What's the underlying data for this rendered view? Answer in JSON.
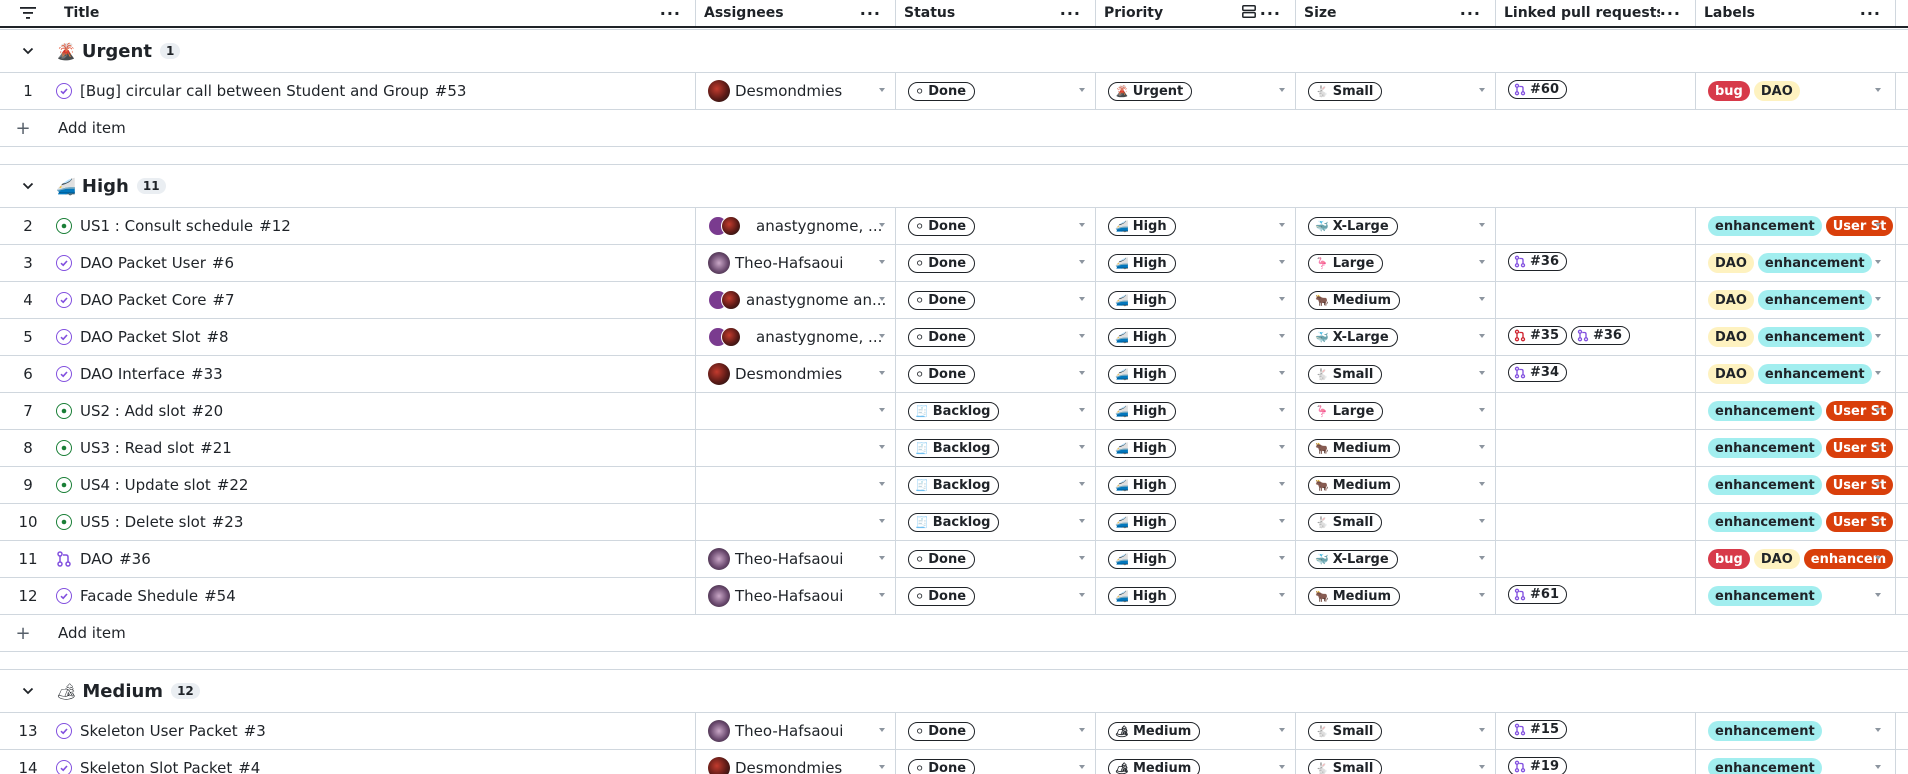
{
  "header": {
    "columns": [
      "Title",
      "Assignees",
      "Status",
      "Priority",
      "Size",
      "Linked pull requests",
      "Labels"
    ]
  },
  "groups": [
    {
      "icon": "🌋",
      "name": "Urgent",
      "count": "1"
    },
    {
      "icon": "🚄",
      "name": "High",
      "count": "11"
    },
    {
      "icon": "🏕",
      "name": "Medium",
      "count": "12"
    }
  ],
  "add_item_label": "Add item",
  "rows": [
    {
      "num": "1",
      "state": "closed",
      "title": "[Bug] circular call between Student and Group",
      "ref": "#53",
      "assignee": "Desmondmies",
      "status": "Done",
      "priority": "Urgent",
      "size": "Small",
      "prs": [
        "#60"
      ],
      "labels": [
        "bug",
        "DAO"
      ]
    },
    {
      "num": "2",
      "state": "open",
      "title": "US1 : Consult schedule",
      "ref": "#12",
      "assignee": "anastygnome, ...",
      "status": "Done",
      "priority": "High",
      "size": "X-Large",
      "prs": [],
      "labels": [
        "enhancement",
        "User St"
      ]
    },
    {
      "num": "3",
      "state": "closed",
      "title": "DAO Packet User",
      "ref": "#6",
      "assignee": "Theo-Hafsaoui",
      "status": "Done",
      "priority": "High",
      "size": "Large",
      "prs": [
        "#36"
      ],
      "labels": [
        "DAO",
        "enhancement"
      ]
    },
    {
      "num": "4",
      "state": "closed",
      "title": "DAO Packet Core",
      "ref": "#7",
      "assignee": "anastygnome an...",
      "status": "Done",
      "priority": "High",
      "size": "Medium",
      "prs": [],
      "labels": [
        "DAO",
        "enhancement"
      ]
    },
    {
      "num": "5",
      "state": "closed",
      "title": "DAO Packet Slot",
      "ref": "#8",
      "assignee": "anastygnome, ...",
      "status": "Done",
      "priority": "High",
      "size": "X-Large",
      "prs": [
        "#35",
        "#36"
      ],
      "labels": [
        "DAO",
        "enhancement"
      ]
    },
    {
      "num": "6",
      "state": "closed",
      "title": "DAO Interface",
      "ref": "#33",
      "assignee": "Desmondmies",
      "status": "Done",
      "priority": "High",
      "size": "Small",
      "prs": [
        "#34"
      ],
      "labels": [
        "DAO",
        "enhancement"
      ]
    },
    {
      "num": "7",
      "state": "open",
      "title": "US2 : Add slot",
      "ref": "#20",
      "assignee": "",
      "status": "Backlog",
      "priority": "High",
      "size": "Large",
      "prs": [],
      "labels": [
        "enhancement",
        "User St"
      ]
    },
    {
      "num": "8",
      "state": "open",
      "title": "US3 : Read slot",
      "ref": "#21",
      "assignee": "",
      "status": "Backlog",
      "priority": "High",
      "size": "Medium",
      "prs": [],
      "labels": [
        "enhancement",
        "User St"
      ]
    },
    {
      "num": "9",
      "state": "open",
      "title": "US4 : Update slot",
      "ref": "#22",
      "assignee": "",
      "status": "Backlog",
      "priority": "High",
      "size": "Medium",
      "prs": [],
      "labels": [
        "enhancement",
        "User St"
      ]
    },
    {
      "num": "10",
      "state": "open",
      "title": "US5 : Delete slot",
      "ref": "#23",
      "assignee": "",
      "status": "Backlog",
      "priority": "High",
      "size": "Small",
      "prs": [],
      "labels": [
        "enhancement",
        "User St"
      ]
    },
    {
      "num": "11",
      "state": "pr",
      "title": "DAO",
      "ref": "#36",
      "assignee": "Theo-Hafsaoui",
      "status": "Done",
      "priority": "High",
      "size": "X-Large",
      "prs": [],
      "labels": [
        "bug",
        "DAO",
        "enhancem"
      ]
    },
    {
      "num": "12",
      "state": "closed",
      "title": "Facade Shedule",
      "ref": "#54",
      "assignee": "Theo-Hafsaoui",
      "status": "Done",
      "priority": "High",
      "size": "Medium",
      "prs": [
        "#61"
      ],
      "labels": [
        "enhancement"
      ]
    },
    {
      "num": "13",
      "state": "closed",
      "title": "Skeleton User Packet",
      "ref": "#3",
      "assignee": "Theo-Hafsaoui",
      "status": "Done",
      "priority": "Medium",
      "size": "Small",
      "prs": [
        "#15"
      ],
      "labels": [
        "enhancement"
      ]
    },
    {
      "num": "14",
      "state": "closed",
      "title": "Skeleton Slot Packet",
      "ref": "#4",
      "assignee": "Desmondmies",
      "status": "Done",
      "priority": "Medium",
      "size": "Small",
      "prs": [
        "#19"
      ],
      "labels": [
        "enhancement"
      ]
    }
  ],
  "icons": {
    "status": {
      "Done": "⚪",
      "Backlog": "🧾"
    },
    "priority": {
      "Urgent": "🌋",
      "High": "🚄",
      "Medium": "🏕"
    },
    "size": {
      "Small": "🐇",
      "Medium": "🐂",
      "Large": "🦩",
      "X-Large": "🐳"
    }
  },
  "colors": {
    "bug": "#d73a4a",
    "DAO": "#fef2c0",
    "enhancement": "#a2eeef",
    "user_story": "#d93f0b",
    "closed": "#8250df",
    "open": "#1a7f37"
  }
}
